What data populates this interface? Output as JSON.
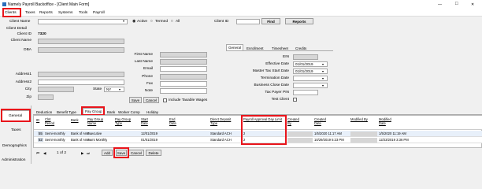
{
  "window": {
    "title": "Namely Payroll Backoffice - [Client Main Form]",
    "controls": [
      "—",
      "□",
      "✕"
    ]
  },
  "menu": [
    "Clients",
    "Taxes",
    "Reports",
    "Systems",
    "Tools",
    "Payroll"
  ],
  "toolbar": {
    "client_name_label": "Client Name",
    "active": "Active",
    "termed": "Termed",
    "all": "All",
    "client_id_label": "Client ID",
    "find": "Find",
    "reports": "Reports"
  },
  "client_detail": {
    "header": "Client Detail",
    "client_id_label": "Client ID",
    "client_id_value": "7320",
    "client_name_label": "Client Name",
    "dba_label": "DBA",
    "address1_label": "Address1",
    "address2_label": "Address2",
    "city_label": "City",
    "state_label": "State",
    "state_value": "NY",
    "zip_label": "Zip",
    "first_name_label": "First Name",
    "last_name_label": "Last Name",
    "email_label": "Email",
    "phone_label": "Phone",
    "fax_label": "Fax",
    "note_label": "Note",
    "save": "Save",
    "cancel": "Cancel",
    "include_taxable_wages": "Include Taxable Wages"
  },
  "right_tabs": [
    "General",
    "Enrollment",
    "Timesheet",
    "Credits"
  ],
  "right_panel": {
    "ein_label": "EIN",
    "effective_date_label": "Effective Date",
    "effective_date_value": "01/01/2019",
    "master_tax_label": "Master Tax Start Date",
    "master_tax_value": "01/01/2019",
    "termination_label": "Termination Date",
    "business_close_label": "Business Close Date",
    "tax_payer_pin_label": "Tax Payer PIN",
    "test_client_label": "Test Client"
  },
  "side_nav": [
    "General",
    "Taxes",
    "Demographics",
    "Administration"
  ],
  "sub_tabs": [
    "Deduction",
    "Benefit Type",
    "Pay Group",
    "Bank",
    "Worker Comp",
    "Holiday"
  ],
  "grid": {
    "headers": [
      "ID",
      "Clnt Period",
      "Bank",
      "Pay Group Name",
      "Pay Group Type",
      "Start Date",
      "End Date",
      "Direct Deposit Type",
      "Payroll Approval Day Limit",
      "Created By",
      "Created Date",
      "Modified By",
      "Modified Date"
    ],
    "rows": [
      {
        "id": "55",
        "period": "Semi-monthly",
        "bank": "Bank of Ame...",
        "name": "Executive",
        "type": "",
        "start": "12/01/2019",
        "end": "",
        "dd": "Standard ACH",
        "limit": "2",
        "created_by": "",
        "created": "1/5/2020 11:17 AM",
        "mod_by": "",
        "modified": "1/5/2020 11:19 AM"
      },
      {
        "id": "52",
        "period": "Semi-monthly",
        "bank": "Bank of Ame...",
        "name": "Semi Monthly",
        "type": "",
        "start": "01/01/2019",
        "end": "",
        "dd": "Standard ACH",
        "limit": "2",
        "created_by": "",
        "created": "10/29/2019 5:23 PM",
        "mod_by": "",
        "modified": "12/23/2019 3:36 PM"
      }
    ]
  },
  "pager": {
    "first": "⏮",
    "prev": "◀",
    "page": "1 of 2",
    "next": "▶",
    "last": "⏭",
    "add": "Add",
    "save": "Save",
    "cancel": "Cancel",
    "delete": "Delete"
  },
  "colors": {
    "highlight": "#e8141b",
    "selected_row": "#e8f0fa"
  }
}
